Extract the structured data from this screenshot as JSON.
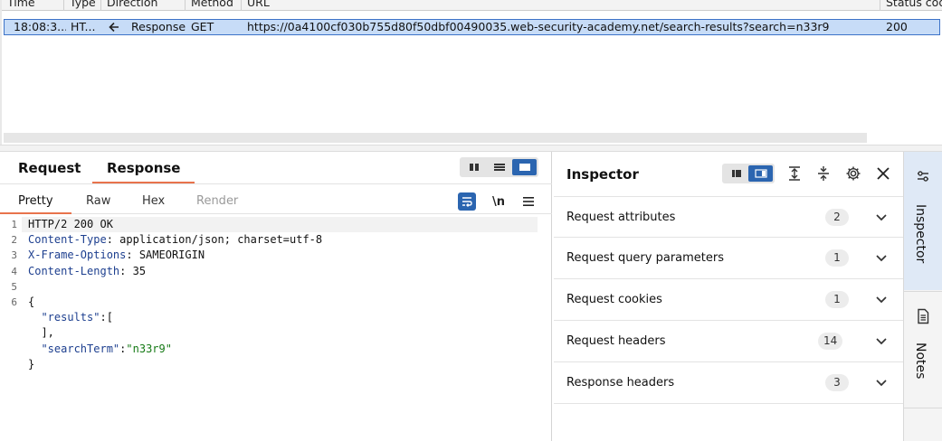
{
  "history": {
    "columns": [
      "Time",
      "Type",
      "Direction",
      "Method",
      "URL",
      "Status code"
    ],
    "row": {
      "time": "18:08:3...",
      "type": "HT...",
      "direction_icon": "arrow-left-icon",
      "direction": "Response",
      "method": "GET",
      "url": "https://0a4100cf030b755d80f50dbf00490035.web-security-academy.net/search-results?search=n33r9",
      "status": "200"
    }
  },
  "editor": {
    "tabs": [
      "Request",
      "Response"
    ],
    "active_tab": "Response",
    "subtabs": [
      "Pretty",
      "Raw",
      "Hex",
      "Render"
    ],
    "active_subtab": "Pretty",
    "newline_toggle": "\\n",
    "line_numbers": [
      "1",
      "2",
      "3",
      "4",
      "5",
      "6"
    ],
    "status_line": "HTTP/2 200 OK",
    "headers": [
      {
        "name": "Content-Type",
        "value": "application/json; charset=utf-8"
      },
      {
        "name": "X-Frame-Options",
        "value": "SAMEORIGIN"
      },
      {
        "name": "Content-Length",
        "value": "35"
      }
    ],
    "body": {
      "open_brace": "{",
      "results_key": "\"results\"",
      "results_open": ":[",
      "results_close": "],",
      "search_key": "\"searchTerm\"",
      "search_sep": ":",
      "search_value": "\"n33r9\"",
      "close_brace": "}"
    }
  },
  "inspector": {
    "title": "Inspector",
    "sections": [
      {
        "label": "Request attributes",
        "count": "2"
      },
      {
        "label": "Request query parameters",
        "count": "1"
      },
      {
        "label": "Request cookies",
        "count": "1"
      },
      {
        "label": "Request headers",
        "count": "14"
      },
      {
        "label": "Response headers",
        "count": "3"
      }
    ]
  },
  "rail": {
    "items": [
      {
        "label": "Inspector",
        "icon": "inspector-icon"
      },
      {
        "label": "Notes",
        "icon": "notes-icon"
      }
    ]
  },
  "colors": {
    "accent": "#e8734c",
    "selection": "#c7dcf7",
    "button_active": "#2b65b0"
  }
}
